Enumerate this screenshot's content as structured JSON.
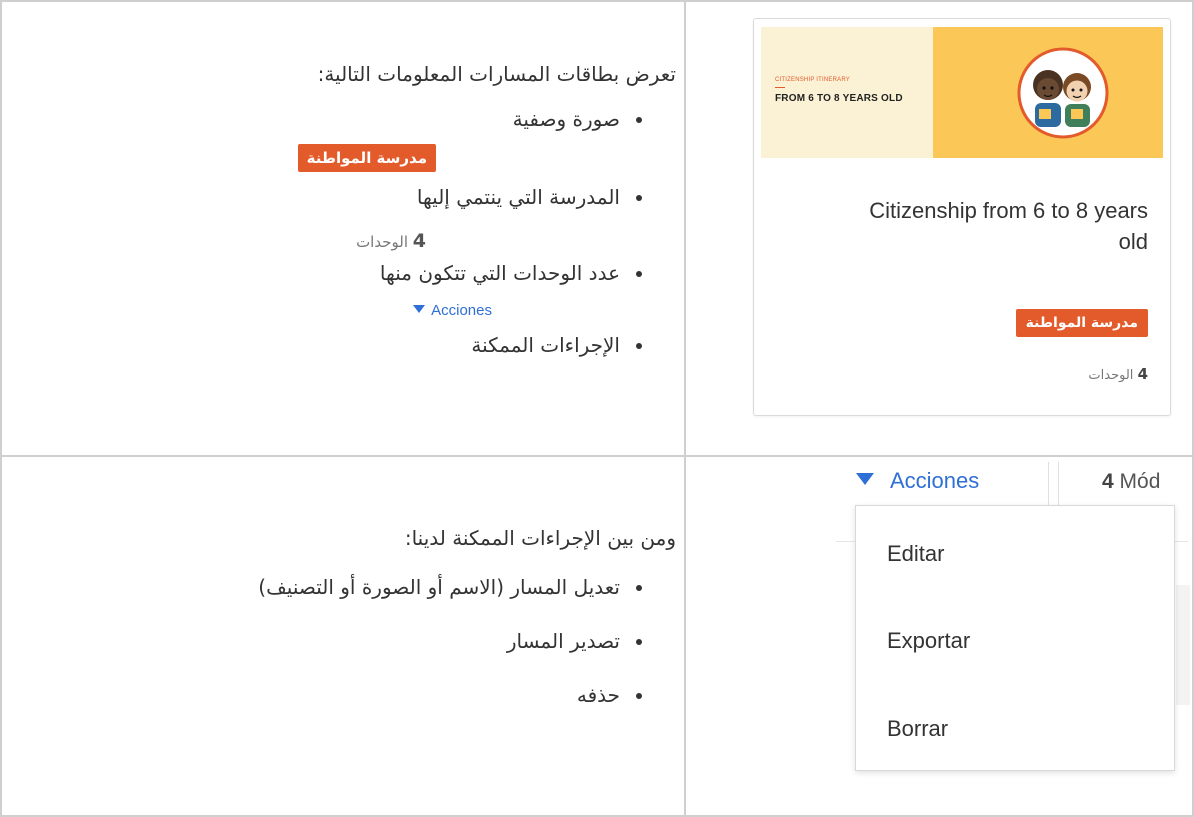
{
  "row1": {
    "intro": "تعرض بطاقات المسارات المعلومات التالية:",
    "items": [
      "صورة وصفية",
      "المدرسة التي ينتمي إليها",
      "عدد الوحدات التي تتكون منها",
      "الإجراءات الممكنة"
    ],
    "inline_badge": "مدرسة المواطنة",
    "inline_units_count": "4",
    "inline_units_label": "الوحدات",
    "inline_actions": "Acciones"
  },
  "card": {
    "cover_kicker": "CITIZENSHIP ITINERARY",
    "cover_title": "FROM 6 TO 8 YEARS OLD",
    "title": "Citizenship from 6 to 8 years old",
    "school_badge": "مدرسة المواطنة",
    "units_count": "4",
    "units_label": "الوحدات"
  },
  "row2": {
    "intro": "ومن بين الإجراءات الممكنة لدينا:",
    "items": [
      "تعديل المسار (الاسم أو الصورة أو التصنيف)",
      "تصدير المسار",
      "حذفه"
    ],
    "actions_label": "Acciones",
    "modules_count": "4",
    "modules_label": "Mód",
    "menu": [
      "Editar",
      "Exportar",
      "Borrar"
    ]
  },
  "colors": {
    "accent_blue": "#2f6fd6",
    "badge_orange": "#e35a2b",
    "cover_yellow": "#fbc857"
  }
}
